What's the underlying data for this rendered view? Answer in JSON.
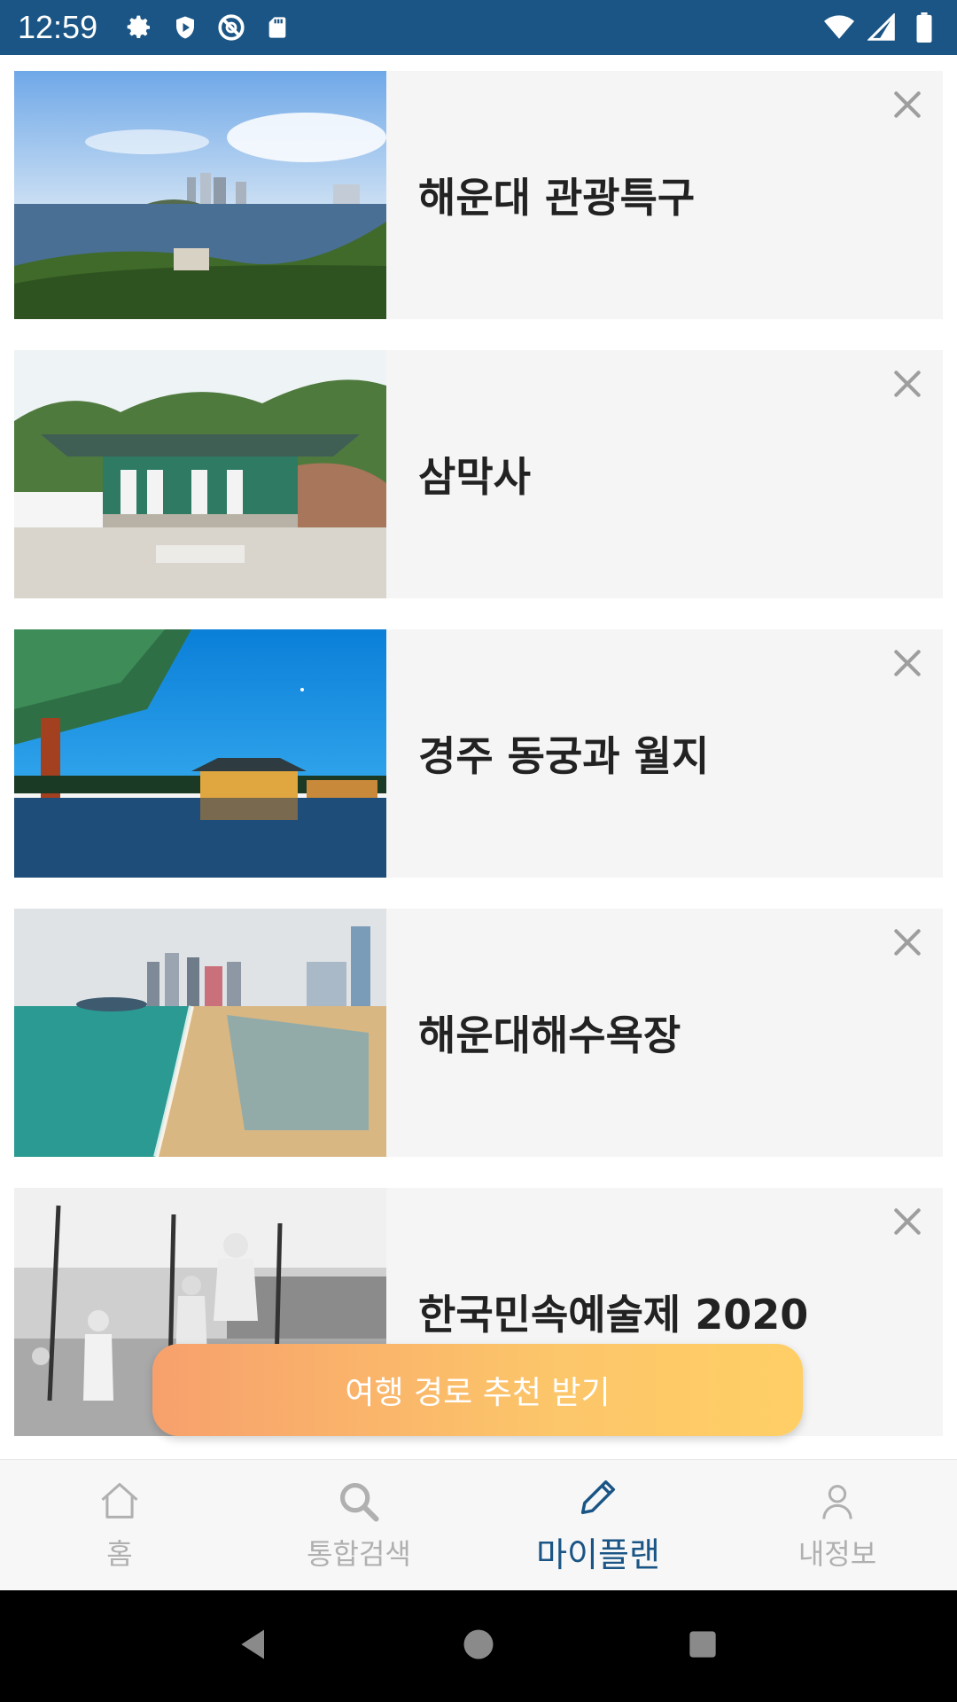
{
  "status_bar": {
    "time": "12:59",
    "left_icons": [
      "gear-icon",
      "shield-icon",
      "no-sync-icon",
      "sd-card-icon"
    ],
    "right_icons": [
      "wifi-icon",
      "signal-icon",
      "battery-icon"
    ]
  },
  "plan_items": [
    {
      "title": "해운대 관광특구",
      "image": "haeundae-special-tourist-zone-photo"
    },
    {
      "title": "삼막사",
      "image": "sammaksa-temple-photo"
    },
    {
      "title": "경주 동궁과 월지",
      "image": "donggung-wolji-night-photo"
    },
    {
      "title": "해운대해수욕장",
      "image": "haeundae-beach-photo"
    },
    {
      "title": "한국민속예술제 2020",
      "image": "folk-art-festival-photo"
    }
  ],
  "cta_label": "여행 경로 추천 받기",
  "bottom_nav": {
    "items": [
      {
        "label": "홈",
        "icon": "home-icon",
        "active": false
      },
      {
        "label": "통합검색",
        "icon": "search-icon",
        "active": false
      },
      {
        "label": "마이플랜",
        "icon": "pencil-icon",
        "active": true
      },
      {
        "label": "내정보",
        "icon": "person-icon",
        "active": false
      }
    ]
  },
  "colors": {
    "status_bar": "#1a5585",
    "active_nav": "#1a5585",
    "inactive_nav": "#b0b0b0",
    "cta_gradient_start": "#f7a06c",
    "cta_gradient_end": "#ffcf66"
  }
}
